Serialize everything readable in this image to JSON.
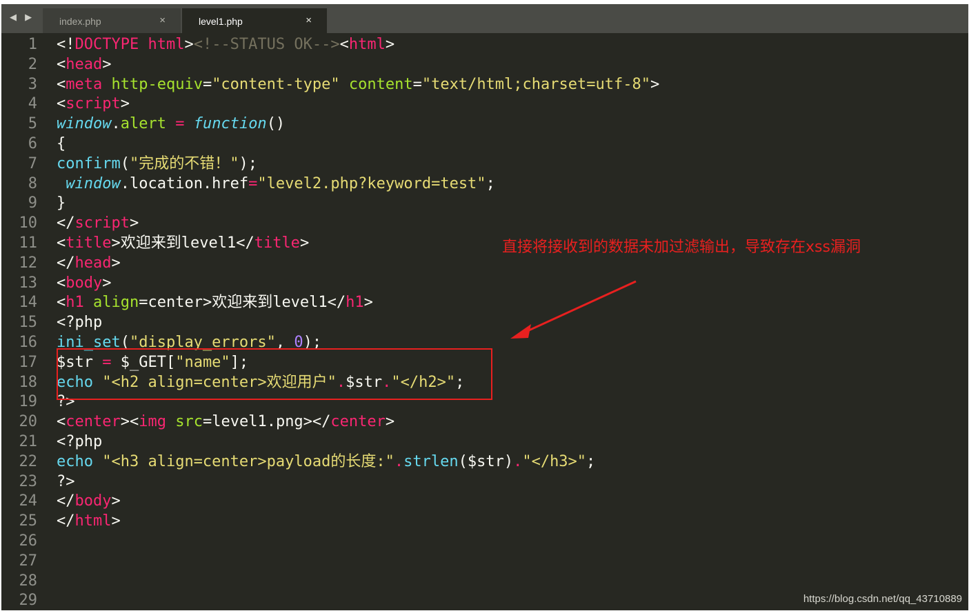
{
  "tabs": [
    {
      "label": "index.php",
      "active": false
    },
    {
      "label": "level1.php",
      "active": true
    }
  ],
  "nav_arrows": "◀ ▶",
  "close_glyph": "×",
  "lines": [
    {
      "n": "1",
      "tokens": [
        [
          "pl",
          "<!"
        ],
        [
          "kw",
          "DOCTYPE"
        ],
        [
          "pl",
          " "
        ],
        [
          "kw",
          "html"
        ],
        [
          "pl",
          ">"
        ],
        [
          "cmt",
          "<!--STATUS OK-->"
        ],
        [
          "pl",
          "<"
        ],
        [
          "kw",
          "html"
        ],
        [
          "pl",
          ">"
        ]
      ]
    },
    {
      "n": "2",
      "tokens": [
        [
          "pl",
          "<"
        ],
        [
          "kw",
          "head"
        ],
        [
          "pl",
          ">"
        ]
      ]
    },
    {
      "n": "3",
      "tokens": [
        [
          "pl",
          "<"
        ],
        [
          "kw",
          "meta"
        ],
        [
          "pl",
          " "
        ],
        [
          "attr",
          "http-equiv"
        ],
        [
          "pl",
          "="
        ],
        [
          "str",
          "\"content-type\""
        ],
        [
          "pl",
          " "
        ],
        [
          "attr",
          "content"
        ],
        [
          "pl",
          "="
        ],
        [
          "str",
          "\"text/html;charset=utf-8\""
        ],
        [
          "pl",
          ">"
        ]
      ]
    },
    {
      "n": "4",
      "tokens": [
        [
          "pl",
          "<"
        ],
        [
          "kw",
          "script"
        ],
        [
          "pl",
          ">"
        ]
      ]
    },
    {
      "n": "5",
      "tokens": [
        [
          "ital",
          "window"
        ],
        [
          "pl",
          "."
        ],
        [
          "attr",
          "alert"
        ],
        [
          "pl",
          " "
        ],
        [
          "kw",
          "="
        ],
        [
          "pl",
          " "
        ],
        [
          "ital",
          "function"
        ],
        [
          "pl",
          "()"
        ]
      ]
    },
    {
      "n": "6",
      "tokens": [
        [
          "pl",
          "{"
        ]
      ]
    },
    {
      "n": "7",
      "tokens": [
        [
          "fn",
          "confirm"
        ],
        [
          "pl",
          "("
        ],
        [
          "str",
          "\"完成的不错！\""
        ],
        [
          "pl",
          ");"
        ]
      ]
    },
    {
      "n": "8",
      "tokens": [
        [
          "pl",
          " "
        ],
        [
          "ital",
          "window"
        ],
        [
          "pl",
          ".location.href"
        ],
        [
          "kw",
          "="
        ],
        [
          "str",
          "\"level2.php?keyword=test\""
        ],
        [
          "pl",
          ";"
        ]
      ]
    },
    {
      "n": "9",
      "tokens": [
        [
          "pl",
          "}"
        ]
      ]
    },
    {
      "n": "10",
      "tokens": [
        [
          "pl",
          "</"
        ],
        [
          "kw",
          "script"
        ],
        [
          "pl",
          ">"
        ]
      ]
    },
    {
      "n": "11",
      "tokens": [
        [
          "pl",
          "<"
        ],
        [
          "kw",
          "title"
        ],
        [
          "pl",
          ">欢迎来到level1</"
        ],
        [
          "kw",
          "title"
        ],
        [
          "pl",
          ">"
        ]
      ]
    },
    {
      "n": "12",
      "tokens": [
        [
          "pl",
          "</"
        ],
        [
          "kw",
          "head"
        ],
        [
          "pl",
          ">"
        ]
      ]
    },
    {
      "n": "13",
      "tokens": [
        [
          "pl",
          "<"
        ],
        [
          "kw",
          "body"
        ],
        [
          "pl",
          ">"
        ]
      ]
    },
    {
      "n": "14",
      "tokens": [
        [
          "pl",
          "<"
        ],
        [
          "kw",
          "h1"
        ],
        [
          "pl",
          " "
        ],
        [
          "attr",
          "align"
        ],
        [
          "pl",
          "=center>欢迎来到level1</"
        ],
        [
          "kw",
          "h1"
        ],
        [
          "pl",
          ">"
        ]
      ]
    },
    {
      "n": "15",
      "tokens": [
        [
          "pl",
          "<?php"
        ]
      ]
    },
    {
      "n": "16",
      "tokens": [
        [
          "fn",
          "ini_set"
        ],
        [
          "pl",
          "("
        ],
        [
          "str",
          "\"display_errors\""
        ],
        [
          "pl",
          ", "
        ],
        [
          "num",
          "0"
        ],
        [
          "pl",
          ");"
        ]
      ]
    },
    {
      "n": "17",
      "tokens": [
        [
          "pl",
          "$str "
        ],
        [
          "kw",
          "="
        ],
        [
          "pl",
          " $_GET["
        ],
        [
          "str",
          "\"name\""
        ],
        [
          "pl",
          "];"
        ]
      ]
    },
    {
      "n": "18",
      "tokens": [
        [
          "fn",
          "echo"
        ],
        [
          "pl",
          " "
        ],
        [
          "str",
          "\"<h2 align=center>欢迎用户\""
        ],
        [
          "kw",
          "."
        ],
        [
          "pl",
          "$str"
        ],
        [
          "kw",
          "."
        ],
        [
          "str",
          "\"</h2>\""
        ],
        [
          "pl",
          ";"
        ]
      ]
    },
    {
      "n": "19",
      "tokens": [
        [
          "pl",
          "?>"
        ]
      ]
    },
    {
      "n": "20",
      "tokens": [
        [
          "pl",
          "<"
        ],
        [
          "kw",
          "center"
        ],
        [
          "pl",
          "><"
        ],
        [
          "kw",
          "img"
        ],
        [
          "pl",
          " "
        ],
        [
          "attr",
          "src"
        ],
        [
          "pl",
          "=level1.png></"
        ],
        [
          "kw",
          "center"
        ],
        [
          "pl",
          ">"
        ]
      ]
    },
    {
      "n": "21",
      "tokens": [
        [
          "pl",
          "<?php"
        ]
      ]
    },
    {
      "n": "22",
      "tokens": [
        [
          "fn",
          "echo"
        ],
        [
          "pl",
          " "
        ],
        [
          "str",
          "\"<h3 align=center>payload的长度:\""
        ],
        [
          "kw",
          "."
        ],
        [
          "fn",
          "strlen"
        ],
        [
          "pl",
          "($str)"
        ],
        [
          "kw",
          "."
        ],
        [
          "str",
          "\"</h3>\""
        ],
        [
          "pl",
          ";"
        ]
      ]
    },
    {
      "n": "23",
      "tokens": [
        [
          "pl",
          "?>"
        ]
      ]
    },
    {
      "n": "24",
      "tokens": [
        [
          "pl",
          "</"
        ],
        [
          "kw",
          "body"
        ],
        [
          "pl",
          ">"
        ]
      ]
    },
    {
      "n": "25",
      "tokens": [
        [
          "pl",
          "</"
        ],
        [
          "kw",
          "html"
        ],
        [
          "pl",
          ">"
        ]
      ]
    },
    {
      "n": "26",
      "tokens": []
    },
    {
      "n": "27",
      "tokens": []
    },
    {
      "n": "28",
      "tokens": []
    },
    {
      "n": "29",
      "tokens": []
    }
  ],
  "annotation": {
    "text": "直接将接收到的数据未加过滤输出，导致存在xss漏洞",
    "color": "#e8201f"
  },
  "watermark": "https://blog.csdn.net/qq_43710889",
  "colors": {
    "background": "#272822",
    "keyword": "#f92672",
    "attribute": "#a6e22e",
    "string": "#e6db74",
    "function": "#66d9ef",
    "number": "#ae81ff",
    "comment": "#75715e",
    "gutter": "#8f908a"
  }
}
